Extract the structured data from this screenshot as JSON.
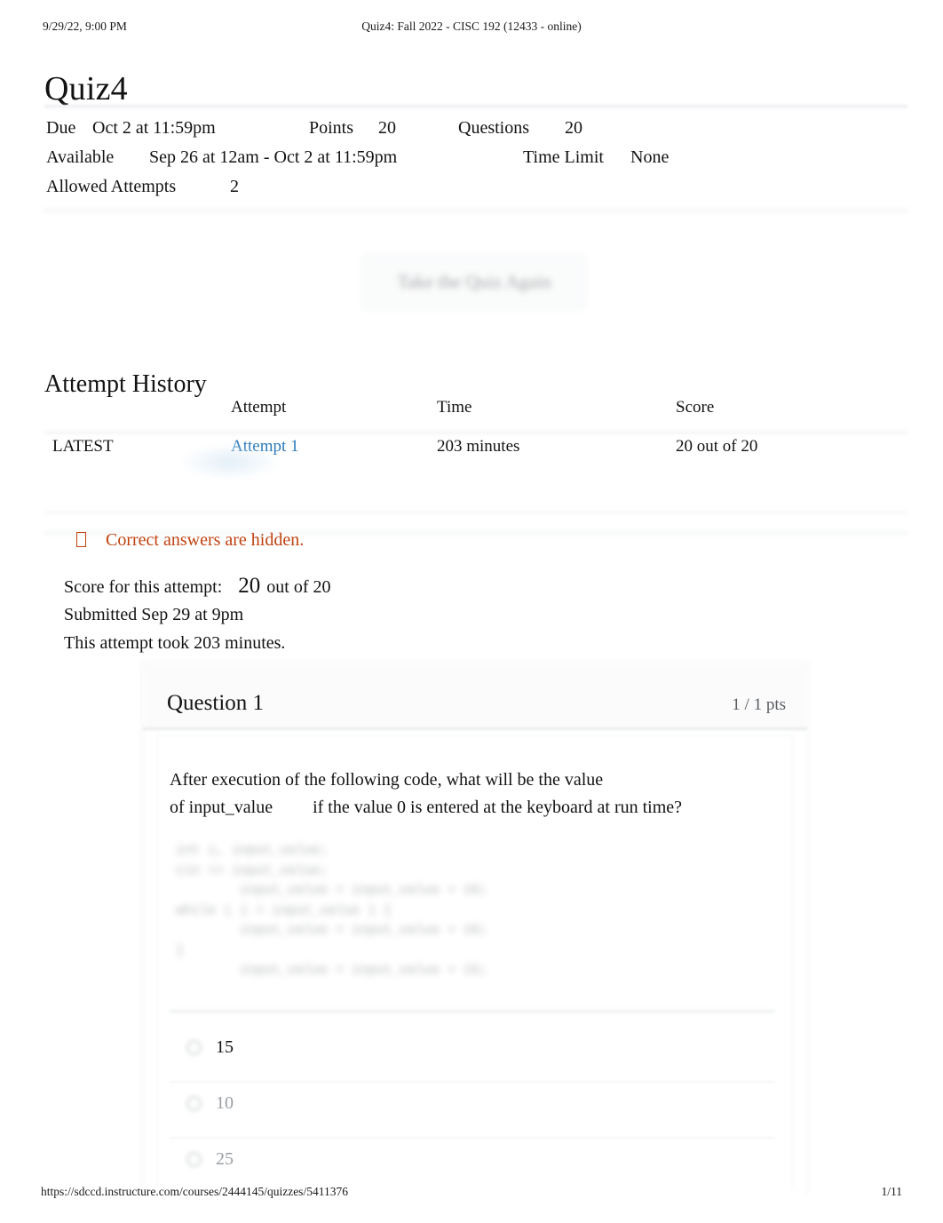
{
  "print_header": {
    "timestamp": "9/29/22, 9:00 PM",
    "document_title": "Quiz4: Fall 2022 - CISC 192 (12433 - online)"
  },
  "page_title": "Quiz4",
  "quiz_meta": {
    "due_label": "Due",
    "due_value": "Oct 2 at 11:59pm",
    "points_label": "Points",
    "points_value": "20",
    "questions_label": "Questions",
    "questions_value": "20",
    "available_label": "Available",
    "available_value": "Sep 26 at 12am - Oct 2 at 11:59pm",
    "time_limit_label": "Time Limit",
    "time_limit_value": "None",
    "allowed_attempts_label": "Allowed Attempts",
    "allowed_attempts_value": "2"
  },
  "retake_button": {
    "label": "Take the Quiz Again"
  },
  "attempt_history": {
    "heading": "Attempt History",
    "columns": [
      "",
      "Attempt",
      "Time",
      "Score"
    ],
    "rows": [
      {
        "marker": "LATEST",
        "attempt": "Attempt 1",
        "time": "203 minutes",
        "score": "20 out of 20"
      }
    ]
  },
  "notice": {
    "icon": "warning-tofu-icon",
    "text": "Correct answers are hidden.",
    "color": "#c0420f"
  },
  "attempt_summary": {
    "score_label": "Score for this attempt:",
    "score_value": "20",
    "score_outof": "out of 20",
    "submitted": "Submitted Sep 29 at 9pm",
    "duration": "This attempt took 203 minutes."
  },
  "question": {
    "title": "Question 1",
    "points": "1 / 1 pts",
    "prompt_line1": "After execution of the following code, what will be the value",
    "prompt_line2_a": "of input_value",
    "prompt_line2_b": "if the value 0 is entered at the keyboard at run time?",
    "code": "int i, input_value;\ncin >> input_value;\n        input_value = input_value + 10;\nwhile ( i < input_value ) {\n        input_value = input_value + 10;\n}\n        input_value = input_value + 15;",
    "answers": [
      {
        "label": "15",
        "state": "selected"
      },
      {
        "label": "10",
        "state": "dim"
      },
      {
        "label": "25",
        "state": "dim"
      }
    ]
  },
  "print_footer": {
    "url": "https://sdccd.instructure.com/courses/2444145/quizzes/5411376",
    "page": "1/11"
  },
  "colors": {
    "link_blue": "#2a7ab9",
    "notice_orange": "#c0420f",
    "text": "#121212",
    "muted": "#9a9ea2"
  }
}
